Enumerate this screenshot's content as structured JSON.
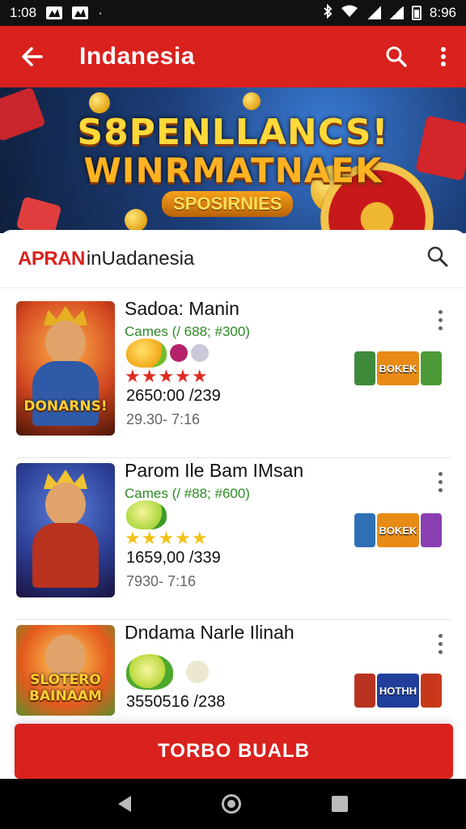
{
  "status_bar": {
    "time_left": "1:08",
    "time_right": "8:96",
    "dot": "·",
    "icons": [
      "image-icon",
      "gallery-icon",
      "bluetooth-icon",
      "wifi-icon",
      "signal-icon",
      "battery-icon"
    ]
  },
  "app_bar": {
    "title": "Indanesia",
    "back_icon": "arrow-left-icon",
    "search_icon": "search-icon",
    "more_icon": "more-vert-icon"
  },
  "banner": {
    "line1": "S8PENLLANCS!",
    "line2": "WINRMATNAEK",
    "line3": "SPOSIRNIES"
  },
  "subheader": {
    "logo": "APRAN",
    "text": "inUadanesia"
  },
  "items": [
    {
      "name": "Sadoa: Manin",
      "meta": "Cames (/ 688; #300)",
      "stars": "★★★★★",
      "star_color": "#e02b20",
      "price": "2650:00 /239",
      "time": "29.30- 7:16",
      "thumb_text": "DONARNS!",
      "tile_text": "BOKEK"
    },
    {
      "name": "Parom Ile Bam IMsan",
      "meta": "Cames (/ #88; #600)",
      "stars": "★★★★★",
      "star_color": "#f2c21a",
      "price": "1659,00 /339",
      "time": "7930- 7:16",
      "thumb_text": "",
      "tile_text": "BOKEK"
    },
    {
      "name": "Dndama Narle Ilinah",
      "meta": "",
      "stars": "",
      "star_color": "#f2c21a",
      "price": "3550516 /238",
      "time": "",
      "thumb_text": "SLOTERO BAINAAM",
      "tile_text": "HOTHH"
    }
  ],
  "cta": {
    "label": "TORBO BUALB"
  },
  "colors": {
    "primary": "#d9211d",
    "meta_green": "#2c8a24"
  }
}
